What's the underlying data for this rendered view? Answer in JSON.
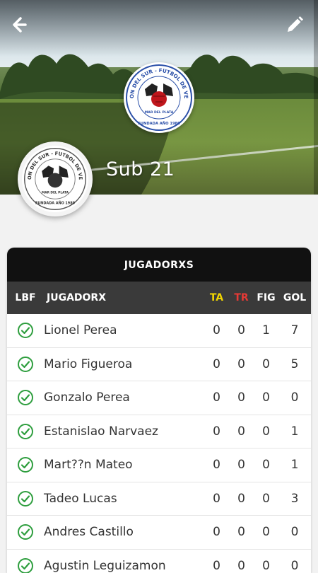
{
  "header": {
    "team_name": "Sub 21",
    "back_icon": "arrow-left-icon",
    "edit_icon": "pencil-icon",
    "club_logo": "asociacion-del-sur-crest",
    "club_logo_text": {
      "ring": "ASOCIACION DEL SUR - FUTBOL DE VETERANOS",
      "city": "MAR DEL PLATA",
      "founded": "FUNDADA AÑO 1980"
    }
  },
  "table": {
    "title": "JUGADORXS",
    "columns": {
      "lbf": "LBF",
      "name": "JUGADORX",
      "ta": "TA",
      "tr": "TR",
      "fig": "FIG",
      "gol": "GOL"
    },
    "rows": [
      {
        "name": "Lionel Perea",
        "ta": "0",
        "tr": "0",
        "fig": "1",
        "gol": "7"
      },
      {
        "name": "Mario Figueroa",
        "ta": "0",
        "tr": "0",
        "fig": "0",
        "gol": "5"
      },
      {
        "name": "Gonzalo Perea",
        "ta": "0",
        "tr": "0",
        "fig": "0",
        "gol": "0"
      },
      {
        "name": "Estanislao Narvaez",
        "ta": "0",
        "tr": "0",
        "fig": "0",
        "gol": "1"
      },
      {
        "name": "Mart??n Mateo",
        "ta": "0",
        "tr": "0",
        "fig": "0",
        "gol": "1"
      },
      {
        "name": "Tadeo Lucas",
        "ta": "0",
        "tr": "0",
        "fig": "0",
        "gol": "3"
      },
      {
        "name": "Andres Castillo",
        "ta": "0",
        "tr": "0",
        "fig": "0",
        "gol": "0"
      },
      {
        "name": "Agustin Leguizamon",
        "ta": "0",
        "tr": "0",
        "fig": "0",
        "gol": "0"
      }
    ]
  },
  "colors": {
    "check": "#2e9e3e",
    "ta": "#f2d600",
    "tr": "#e53935",
    "header_bg": "#111111",
    "thead_bg": "#3a3a3a"
  }
}
